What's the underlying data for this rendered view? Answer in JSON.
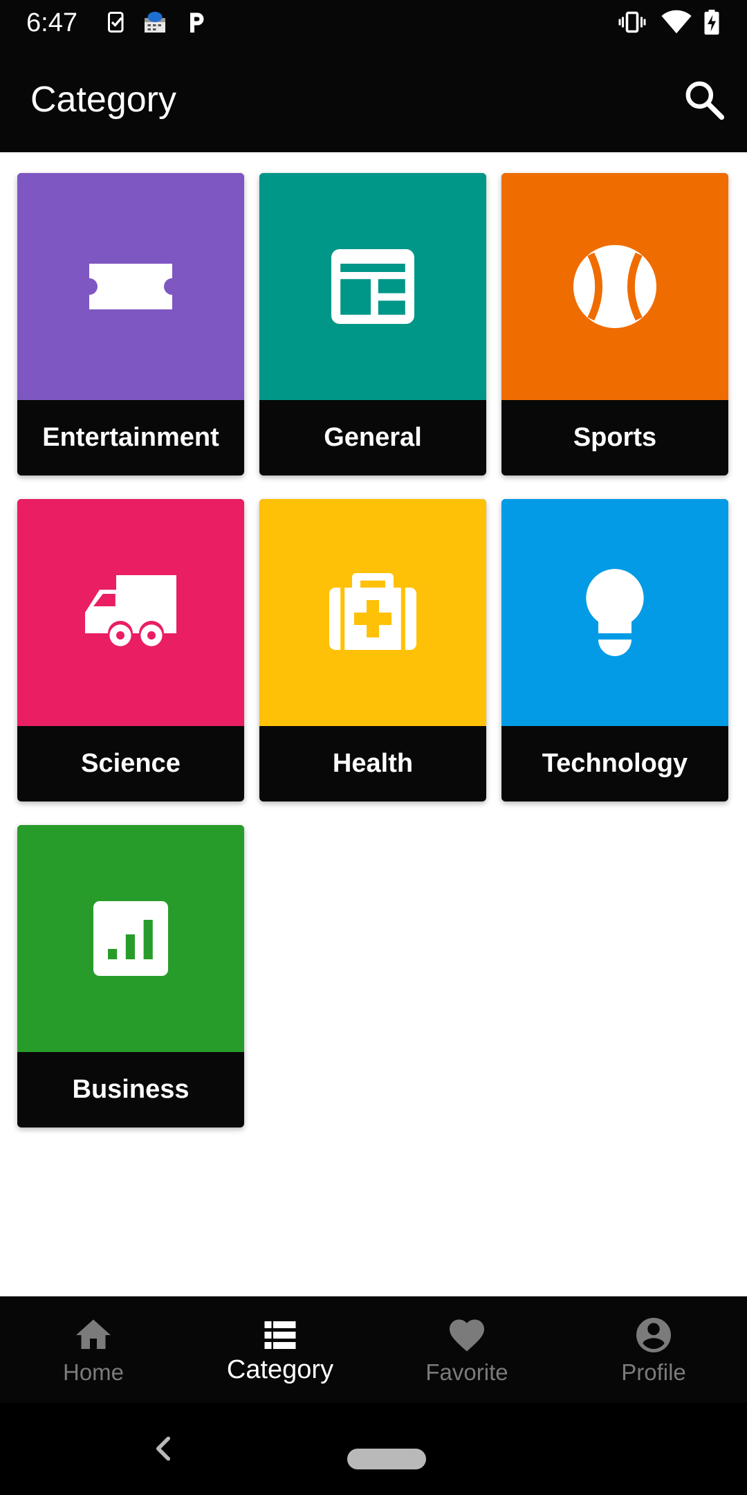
{
  "status_bar": {
    "time": "6:47",
    "left_icons": [
      "task-check-icon",
      "cloud-calendar-icon",
      "parking-p-icon"
    ],
    "right_icons": [
      "vibrate-icon",
      "wifi-icon",
      "battery-charging-icon"
    ]
  },
  "app_bar": {
    "title": "Category",
    "search_icon": "search-icon"
  },
  "categories": [
    {
      "label": "Entertainment",
      "color": "#7E57C2",
      "icon": "ticket-icon"
    },
    {
      "label": "General",
      "color": "#009688",
      "icon": "newspaper-icon"
    },
    {
      "label": "Sports",
      "color": "#EF6C00",
      "icon": "tennis-ball-icon"
    },
    {
      "label": "Science",
      "color": "#E91E63",
      "icon": "truck-icon"
    },
    {
      "label": "Health",
      "color": "#FFC107",
      "icon": "medical-bag-icon"
    },
    {
      "label": "Technology",
      "color": "#039BE5",
      "icon": "lightbulb-icon"
    },
    {
      "label": "Business",
      "color": "#289C2B",
      "icon": "bar-chart-icon"
    }
  ],
  "bottom_nav": {
    "items": [
      {
        "label": "Home",
        "icon": "home-icon",
        "active": false
      },
      {
        "label": "Category",
        "icon": "list-icon",
        "active": true
      },
      {
        "label": "Favorite",
        "icon": "heart-icon",
        "active": false
      },
      {
        "label": "Profile",
        "icon": "account-circle-icon",
        "active": false
      }
    ]
  },
  "system_nav": {
    "back_icon": "back-chevron-icon",
    "home_indicator": "home-pill"
  }
}
